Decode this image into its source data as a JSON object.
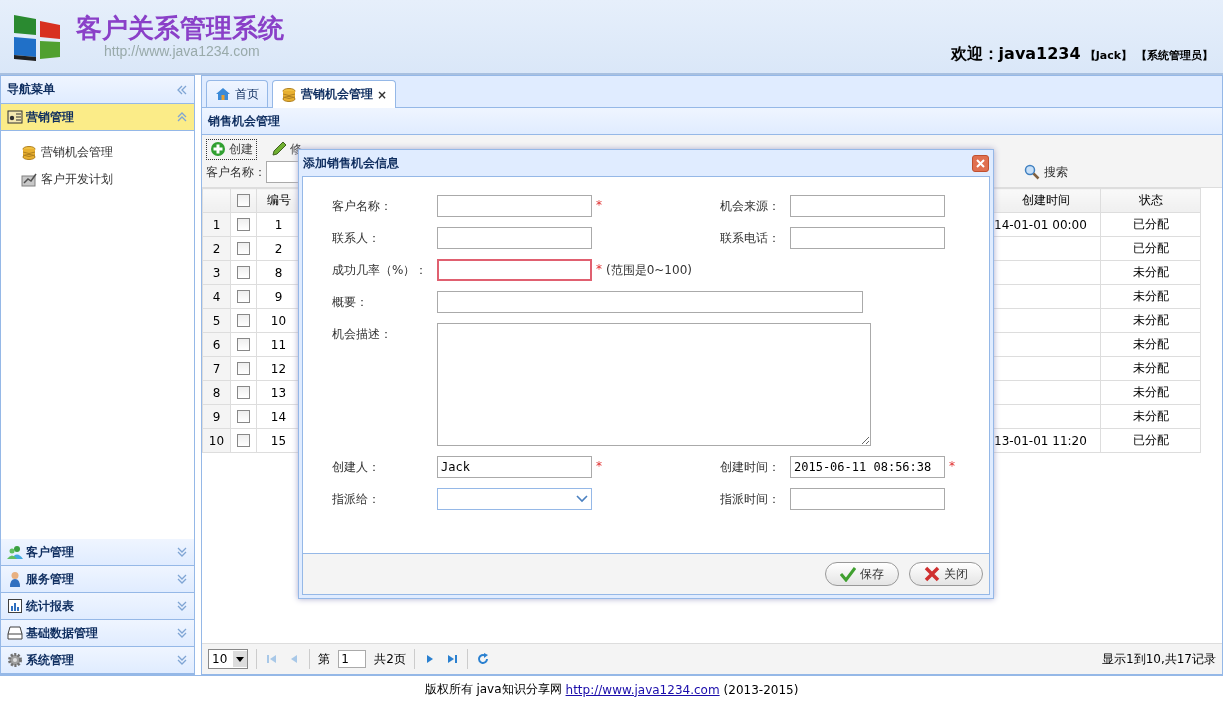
{
  "header": {
    "logo_title": "客户关系管理系统",
    "logo_url": "http://www.java1234.com",
    "welcome": "欢迎：java1234",
    "user": "【Jack】",
    "role": "【系统管理员】"
  },
  "sidebar": {
    "title": "导航菜单",
    "panels": [
      {
        "title": "营销管理",
        "expanded": true,
        "items": [
          {
            "label": "营销机会管理",
            "selected": false
          },
          {
            "label": "客户开发计划",
            "selected": false
          }
        ]
      },
      {
        "title": "客户管理",
        "expanded": false
      },
      {
        "title": "服务管理",
        "expanded": false
      },
      {
        "title": "统计报表",
        "expanded": false
      },
      {
        "title": "基础数据管理",
        "expanded": false
      },
      {
        "title": "系统管理",
        "expanded": false
      }
    ]
  },
  "tabs": [
    {
      "label": "首页",
      "selected": false,
      "closable": false
    },
    {
      "label": "营销机会管理",
      "selected": true,
      "closable": true,
      "close": "×"
    }
  ],
  "panel": {
    "title": "销售机会管理",
    "toolbar": [
      {
        "label": "创建",
        "kind": "add"
      },
      {
        "label": "修",
        "kind": "edit"
      }
    ],
    "search": {
      "label": "客户名称：",
      "button": "搜索"
    },
    "table": {
      "all_checked": false,
      "columns": [
        "编号",
        "创建时间",
        "状态"
      ],
      "rows": [
        {
          "row_number": "1",
          "checked": false,
          "id": "1",
          "created_time": "14-01-01 00:00",
          "status": "已分配"
        },
        {
          "row_number": "2",
          "checked": false,
          "id": "2",
          "status": "已分配"
        },
        {
          "row_number": "3",
          "checked": false,
          "id": "8",
          "status": "未分配"
        },
        {
          "row_number": "4",
          "checked": false,
          "id": "9",
          "status": "未分配"
        },
        {
          "row_number": "5",
          "checked": false,
          "id": "10",
          "status": "未分配"
        },
        {
          "row_number": "6",
          "checked": false,
          "id": "11",
          "status": "未分配"
        },
        {
          "row_number": "7",
          "checked": false,
          "id": "12",
          "status": "未分配"
        },
        {
          "row_number": "8",
          "checked": false,
          "id": "13",
          "status": "未分配"
        },
        {
          "row_number": "9",
          "checked": false,
          "id": "14",
          "status": "未分配"
        },
        {
          "row_number": "10",
          "checked": false,
          "id": "15",
          "created_time": "13-01-01 11:20",
          "status": "已分配"
        }
      ]
    },
    "pager": {
      "page_size": "10",
      "page_prefix": "第",
      "page": "1",
      "page_total": "共2页",
      "summary": "显示1到10,共17记录"
    }
  },
  "dialog": {
    "title": "添加销售机会信息",
    "rows": [
      [
        {
          "label": "客户名称：",
          "kind": "text",
          "mark": "*",
          "invalid": false
        },
        {
          "label": "机会来源：",
          "kind": "text",
          "invalid": false
        }
      ],
      [
        {
          "label": "联系人：",
          "kind": "text",
          "invalid": false
        },
        {
          "label": "联系电话：",
          "kind": "text",
          "invalid": false
        }
      ],
      [
        {
          "label": "成功几率（%）：",
          "kind": "text",
          "mark": "*",
          "invalid": true,
          "hint": "(范围是0~100)"
        }
      ],
      [
        {
          "label": "概要：",
          "kind": "wide",
          "invalid": false
        }
      ],
      [
        {
          "label": "机会描述：",
          "kind": "textarea",
          "invalid": false
        }
      ],
      [
        {
          "label": "创建人：",
          "kind": "text",
          "value": "Jack",
          "mark": "*",
          "invalid": false
        },
        {
          "label": "创建时间：",
          "kind": "text",
          "value": "2015-06-11 08:56:38",
          "mark": "*",
          "invalid": false
        }
      ],
      [
        {
          "label": "指派给：",
          "kind": "select",
          "invalid": false
        },
        {
          "label": "指派时间：",
          "kind": "text",
          "invalid": false
        }
      ]
    ],
    "buttons": [
      {
        "label": "保存",
        "kind": "save"
      },
      {
        "label": "关闭",
        "kind": "close"
      }
    ]
  },
  "footer": {
    "text": "版权所有 java知识分享网",
    "link": "http://www.java1234.com",
    "years": "(2013-2015)"
  }
}
